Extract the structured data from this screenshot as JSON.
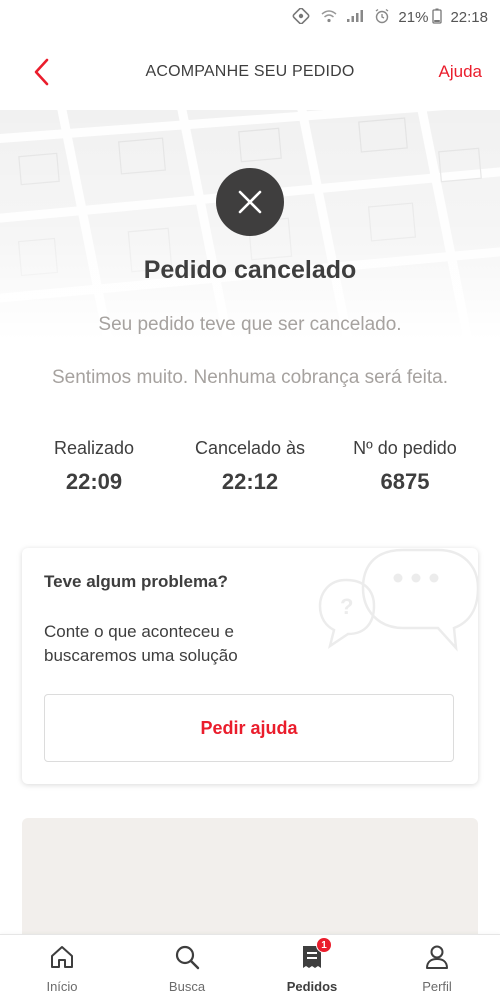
{
  "status_bar": {
    "battery": "21%",
    "time": "22:18"
  },
  "header": {
    "title": "ACOMPANHE SEU PEDIDO",
    "help_label": "Ajuda"
  },
  "order_status": {
    "title": "Pedido cancelado",
    "message_line": "Seu pedido teve que ser cancelado.",
    "apology": "Sentimos muito. Nenhuma cobrança será feita."
  },
  "order_info": [
    {
      "label": "Realizado",
      "value": "22:09"
    },
    {
      "label": "Cancelado às",
      "value": "22:12"
    },
    {
      "label": "Nº do pedido",
      "value": "6875"
    }
  ],
  "help_card": {
    "title": "Teve algum problema?",
    "text": "Conte o que aconteceu e buscaremos uma solução",
    "button_label": "Pedir ajuda"
  },
  "bottom_nav": [
    {
      "label": "Início",
      "icon": "home-icon",
      "active": false
    },
    {
      "label": "Busca",
      "icon": "search-icon",
      "active": false
    },
    {
      "label": "Pedidos",
      "icon": "orders-icon",
      "active": true,
      "badge": "1"
    },
    {
      "label": "Perfil",
      "icon": "profile-icon",
      "active": false
    }
  ],
  "colors": {
    "accent": "#ea1d2c",
    "text": "#3e3e3e",
    "muted": "#a6a29f",
    "cancel_circle": "#3f3e3e"
  }
}
